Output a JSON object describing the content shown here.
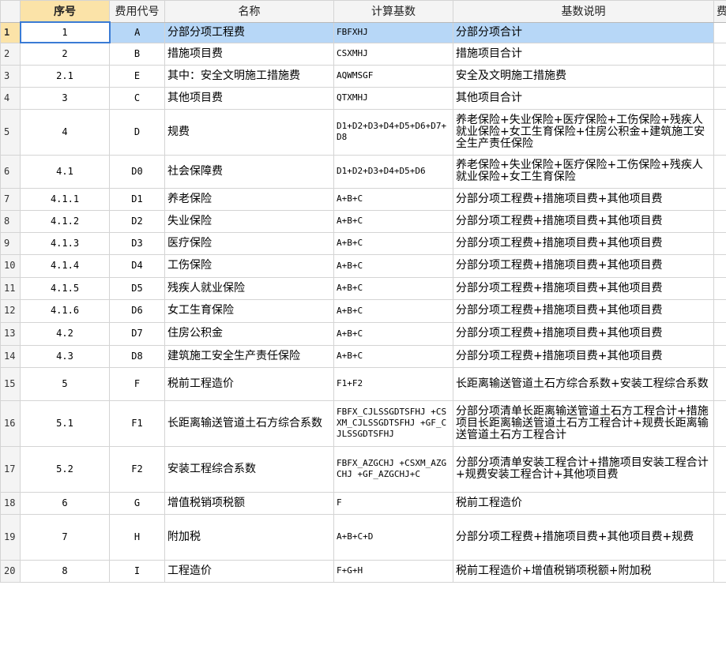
{
  "columns": {
    "seq": "序号",
    "code": "费用代号",
    "name": "名称",
    "base": "计算基数",
    "desc": "基数说明",
    "extra": "费"
  },
  "rows": [
    {
      "rn": "1",
      "seq": "1",
      "code": "A",
      "name": "分部分项工程费",
      "base": "FBFXHJ",
      "desc": "分部分项合计",
      "h": 26
    },
    {
      "rn": "2",
      "seq": "2",
      "code": "B",
      "name": "措施项目费",
      "base": "CSXMHJ",
      "desc": "措施项目合计",
      "h": 28
    },
    {
      "rn": "3",
      "seq": "2.1",
      "code": "E",
      "name": "其中：安全文明施工措施费",
      "base": "AQWMSGF",
      "desc": "安全及文明施工措施费",
      "h": 28
    },
    {
      "rn": "4",
      "seq": "3",
      "code": "C",
      "name": "其他项目费",
      "base": "QTXMHJ",
      "desc": "其他项目合计",
      "h": 28
    },
    {
      "rn": "5",
      "seq": "4",
      "code": "D",
      "name": "规费",
      "base": "D1+D2+D3+D4+D5+D6+D7+D8",
      "desc": "养老保险+失业保险+医疗保险+工伤保险+残疾人就业保险+女工生育保险+住房公积金+建筑施工安全生产责任保险",
      "h": 58
    },
    {
      "rn": "6",
      "seq": "4.1",
      "code": "D0",
      "name": "社会保障费",
      "base": "D1+D2+D3+D4+D5+D6",
      "desc": "养老保险+失业保险+医疗保险+工伤保险+残疾人就业保险+女工生育保险",
      "h": 42
    },
    {
      "rn": "7",
      "seq": "4.1.1",
      "code": "D1",
      "name": "养老保险",
      "base": "A+B+C",
      "desc": "分部分项工程费+措施项目费+其他项目费",
      "h": 28
    },
    {
      "rn": "8",
      "seq": "4.1.2",
      "code": "D2",
      "name": "失业保险",
      "base": "A+B+C",
      "desc": "分部分项工程费+措施项目费+其他项目费",
      "h": 28
    },
    {
      "rn": "9",
      "seq": "4.1.3",
      "code": "D3",
      "name": "医疗保险",
      "base": "A+B+C",
      "desc": "分部分项工程费+措施项目费+其他项目费",
      "h": 28
    },
    {
      "rn": "10",
      "seq": "4.1.4",
      "code": "D4",
      "name": "工伤保险",
      "base": "A+B+C",
      "desc": "分部分项工程费+措施项目费+其他项目费",
      "h": 29
    },
    {
      "rn": "11",
      "seq": "4.1.5",
      "code": "D5",
      "name": "残疾人就业保险",
      "base": "A+B+C",
      "desc": "分部分项工程费+措施项目费+其他项目费",
      "h": 28
    },
    {
      "rn": "12",
      "seq": "4.1.6",
      "code": "D6",
      "name": "女工生育保险",
      "base": "A+B+C",
      "desc": "分部分项工程费+措施项目费+其他项目费",
      "h": 29
    },
    {
      "rn": "13",
      "seq": "4.2",
      "code": "D7",
      "name": "住房公积金",
      "base": "A+B+C",
      "desc": "分部分项工程费+措施项目费+其他项目费",
      "h": 29
    },
    {
      "rn": "14",
      "seq": "4.3",
      "code": "D8",
      "name": "建筑施工安全生产责任保险",
      "base": "A+B+C",
      "desc": "分部分项工程费+措施项目费+其他项目费",
      "h": 28
    },
    {
      "rn": "15",
      "seq": "5",
      "code": "F",
      "name": "税前工程造价",
      "base": "F1+F2",
      "desc": "长距离输送管道土石方综合系数+安装工程综合系数",
      "h": 42
    },
    {
      "rn": "16",
      "seq": "5.1",
      "code": "F1",
      "name": "长距离输送管道土石方综合系数",
      "base": "FBFX_CJLSSGDTSFHJ +CSXM_CJLSSGDTSFHJ +GF_CJLSSGDTSFHJ",
      "desc": "分部分项清单长距离输送管道土石方工程合计+措施项目长距离输送管道土石方工程合计+规费长距离输送管道土石方工程合计",
      "h": 58
    },
    {
      "rn": "17",
      "seq": "5.2",
      "code": "F2",
      "name": "安装工程综合系数",
      "base": "FBFX_AZGCHJ +CSXM_AZGCHJ +GF_AZGCHJ+C",
      "desc": "分部分项清单安装工程合计+措施项目安装工程合计+规费安装工程合计+其他项目费",
      "h": 58
    },
    {
      "rn": "18",
      "seq": "6",
      "code": "G",
      "name": "增值税销项税额",
      "base": "F",
      "desc": "税前工程造价",
      "h": 28
    },
    {
      "rn": "19",
      "seq": "7",
      "code": "H",
      "name": "附加税",
      "base": "A+B+C+D",
      "desc": "分部分项工程费+措施项目费+其他项目费+规费",
      "h": 58
    },
    {
      "rn": "20",
      "seq": "8",
      "code": "I",
      "name": "工程造价",
      "base": "F+G+H",
      "desc": "税前工程造价+增值税销项税额+附加税",
      "h": 28
    }
  ]
}
